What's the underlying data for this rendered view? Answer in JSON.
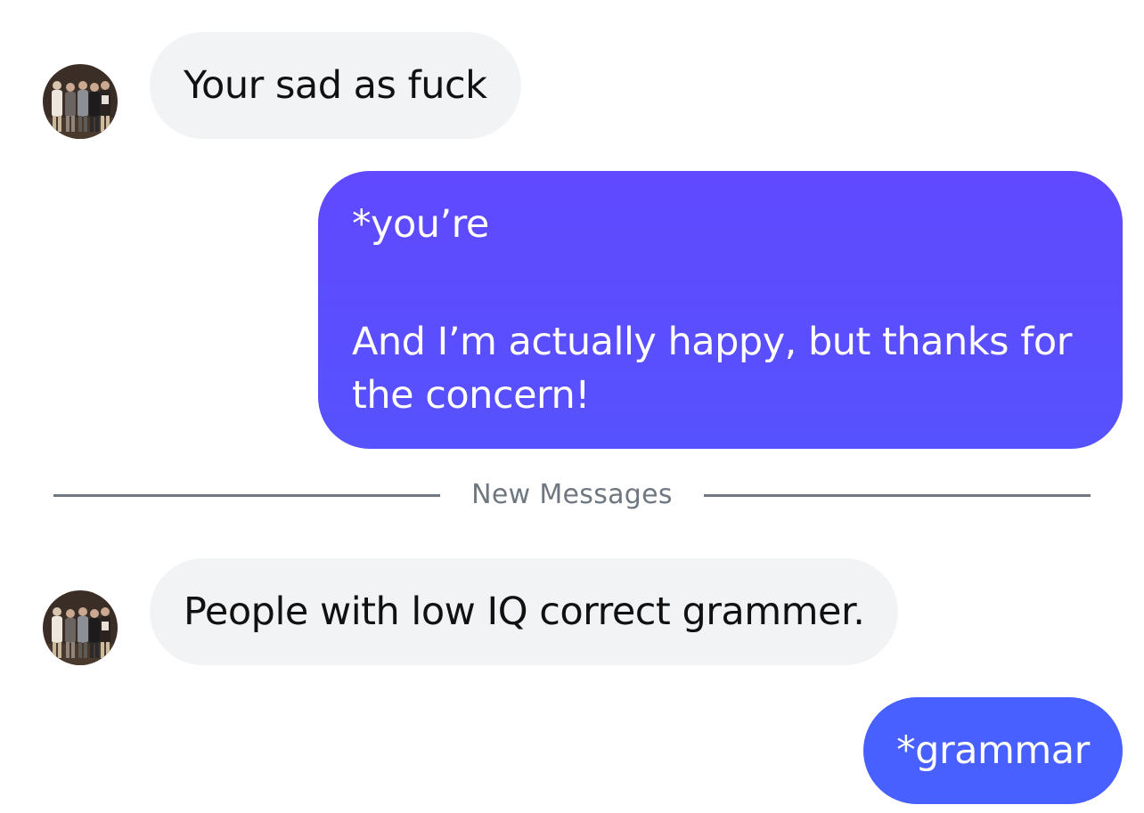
{
  "conversation": {
    "messages": [
      {
        "direction": "incoming",
        "text": "Your sad as fuck"
      },
      {
        "direction": "outgoing",
        "lines": [
          "*you’re",
          "",
          "And I’m actually happy, but thanks for",
          "the concern!"
        ]
      },
      {
        "direction": "incoming",
        "text": "People with low IQ correct grammer."
      },
      {
        "direction": "outgoing",
        "text": "*grammar"
      }
    ],
    "divider_label": "New Messages"
  },
  "colors": {
    "incoming_bubble": "#f2f3f5",
    "outgoing_bubble_top": "#6049ff",
    "outgoing_bubble_bottom": "#4760ff",
    "divider": "#6f7780"
  },
  "icons": {
    "sender_avatar": "group-photo-avatar"
  }
}
